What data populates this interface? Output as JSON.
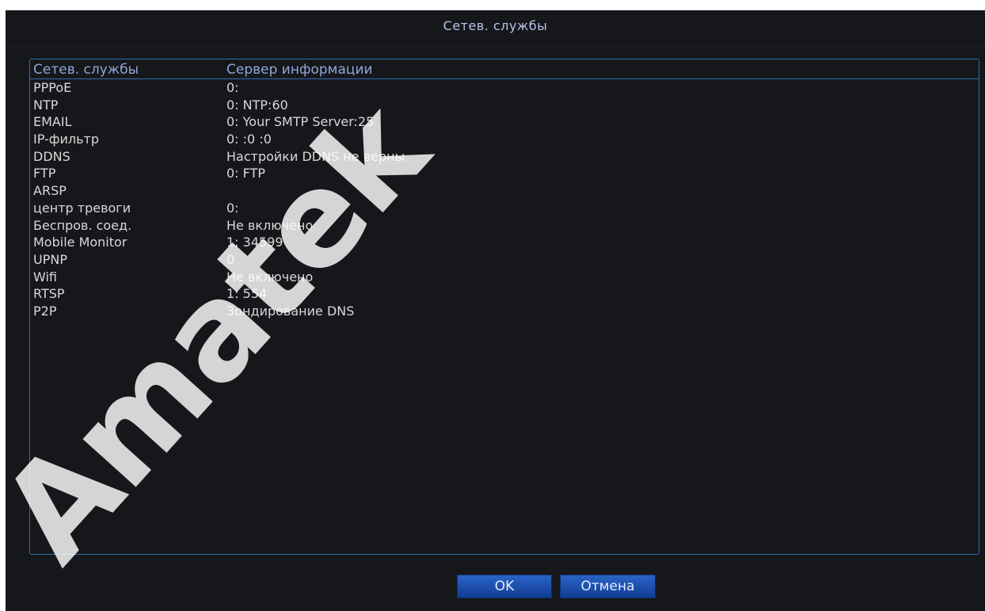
{
  "window": {
    "title": "Сетев. службы"
  },
  "table": {
    "headers": {
      "service": "Сетев. службы",
      "info": "Сервер информации"
    },
    "rows": [
      {
        "service": "PPPoE",
        "info": "0:"
      },
      {
        "service": "NTP",
        "info": "0: NTP:60"
      },
      {
        "service": "EMAIL",
        "info": "0: Your SMTP Server:25"
      },
      {
        "service": "IP-фильтр",
        "info": "0: :0 :0"
      },
      {
        "service": "DDNS",
        "info": "Настройки DDNS не верны"
      },
      {
        "service": "FTP",
        "info": "0: FTP"
      },
      {
        "service": "ARSP",
        "info": ""
      },
      {
        "service": "центр тревоги",
        "info": "0:"
      },
      {
        "service": "Беспров. соед.",
        "info": "Не включено"
      },
      {
        "service": "Mobile Monitor",
        "info": "1: 34599"
      },
      {
        "service": "UPNP",
        "info": "0"
      },
      {
        "service": "Wifi",
        "info": "Не включено"
      },
      {
        "service": "RTSP",
        "info": "1: 554"
      },
      {
        "service": "P2P",
        "info": "Зондирование DNS"
      }
    ]
  },
  "buttons": {
    "ok": "OK",
    "cancel": "Отмена"
  },
  "watermark": "Amatek",
  "colors": {
    "background": "#16171b",
    "border_accent": "#2f6eb4",
    "button": "#1d4fb0"
  }
}
